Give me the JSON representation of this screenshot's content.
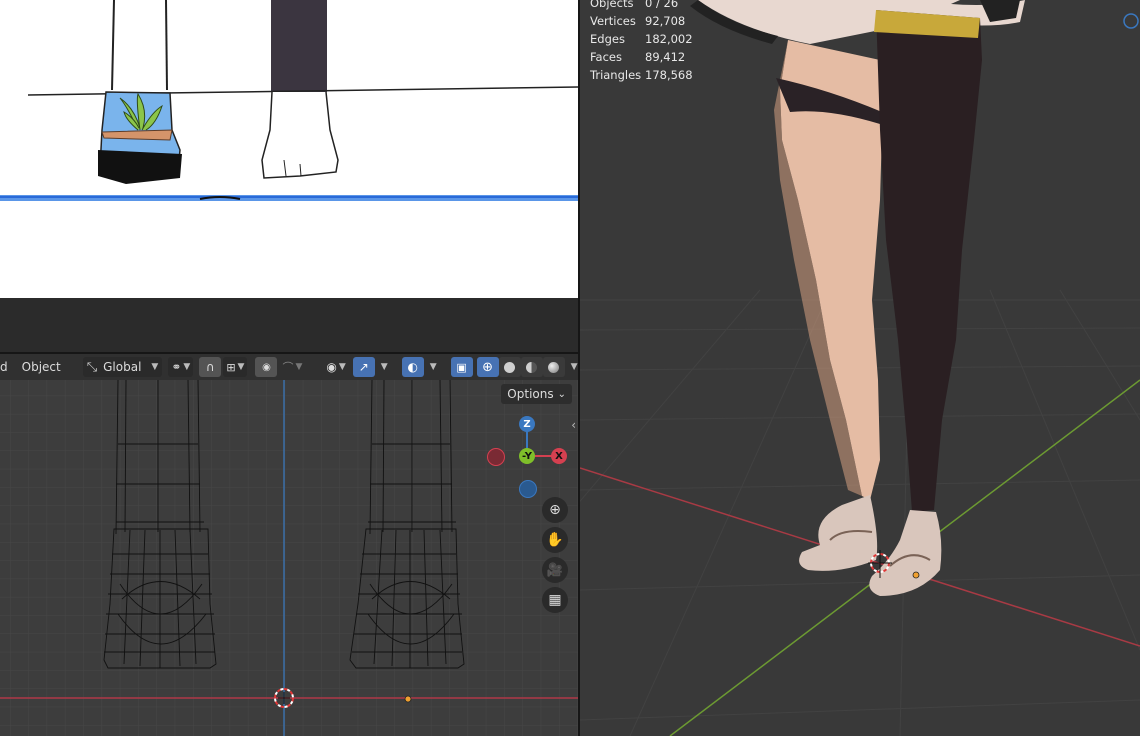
{
  "header": {
    "mode_cut": "d",
    "object_menu": "Object",
    "orientation": "Global",
    "options_label": "Options"
  },
  "gizmo": {
    "z": "Z",
    "y": "-Y",
    "x": "X"
  },
  "stats": [
    {
      "label": "Objects",
      "value": "0 / 26"
    },
    {
      "label": "Vertices",
      "value": "92,708"
    },
    {
      "label": "Edges",
      "value": "182,002"
    },
    {
      "label": "Faces",
      "value": "89,412"
    },
    {
      "label": "Triangles",
      "value": "178,568"
    }
  ],
  "colors": {
    "toggle_active": "#4772b3",
    "axis_x": "#d54050",
    "axis_y": "#7fbf2a",
    "axis_z": "#3a78c0",
    "origin": "#f0a030"
  },
  "icons": [
    "zoom-icon",
    "hand-icon",
    "camera-icon",
    "grid-icon",
    "options-chevron-icon"
  ]
}
